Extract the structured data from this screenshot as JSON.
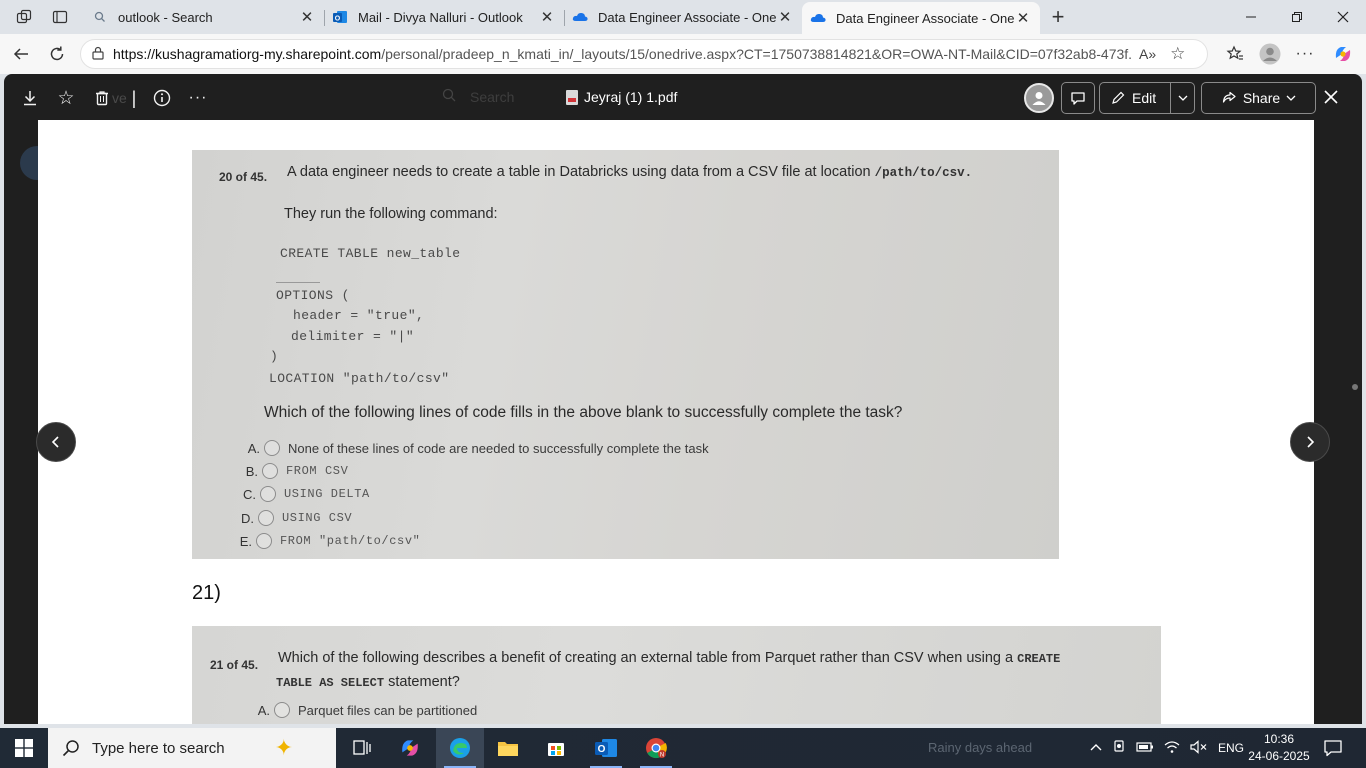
{
  "browser": {
    "tabs": [
      {
        "title": "outlook - Search",
        "icon": "search-icon"
      },
      {
        "title": "Mail - Divya Nalluri - Outlook",
        "icon": "outlook-icon"
      },
      {
        "title": "Data Engineer Associate - OneDri",
        "icon": "onedrive-icon"
      },
      {
        "title": "Data Engineer Associate - OneDri",
        "icon": "onedrive-icon"
      }
    ],
    "active_tab": 3,
    "url_host": "https://kushagramatiorg-my.sharepoint.com",
    "url_path": "/personal/pradeep_n_kmati_in/_layouts/15/onedrive.aspx?CT=1750738814821&OR=OWA-NT-Mail&CID=07f32ab8-473f..."
  },
  "viewer": {
    "file_name": "Jeyraj (1) 1.pdf",
    "search_placeholder": "Search",
    "edit_label": "Edit",
    "share_label": "Share",
    "hint_left": "ve"
  },
  "document": {
    "q20": {
      "number": "20 of 45.",
      "text": "A data engineer needs to create a table in Databricks using data from a CSV file at location",
      "path": "/path/to/csv.",
      "lead": "They run the following command:",
      "code": {
        "line1": "CREATE TABLE new_table",
        "line2": "OPTIONS (",
        "line3": "header = \"true\",",
        "line4": "delimiter = \"|\"",
        "line5": ")",
        "line6": "LOCATION \"path/to/csv\""
      },
      "question": "Which of the following lines of code fills in the above blank to successfully complete the task?",
      "options": [
        {
          "letter": "A.",
          "text": "None of these lines of code are needed to successfully complete the task"
        },
        {
          "letter": "B.",
          "text": "FROM CSV"
        },
        {
          "letter": "C.",
          "text": "USING DELTA"
        },
        {
          "letter": "D.",
          "text": "USING CSV"
        },
        {
          "letter": "E.",
          "text": "FROM \"path/to/csv\""
        }
      ]
    },
    "heading": "21)",
    "q21": {
      "number": "21 of 45.",
      "text": "Which of the following describes a benefit of creating an external table from Parquet rather than CSV when using a",
      "code1": "CREATE",
      "code2": "TABLE AS SELECT",
      "text2": "statement?",
      "options": [
        {
          "letter": "A.",
          "text": "Parquet files can be partitioned"
        }
      ]
    }
  },
  "taskbar": {
    "search_placeholder": "Type here to search",
    "weather": "Rainy days ahead",
    "language": "ENG",
    "time": "10:36",
    "date": "24-06-2025"
  }
}
